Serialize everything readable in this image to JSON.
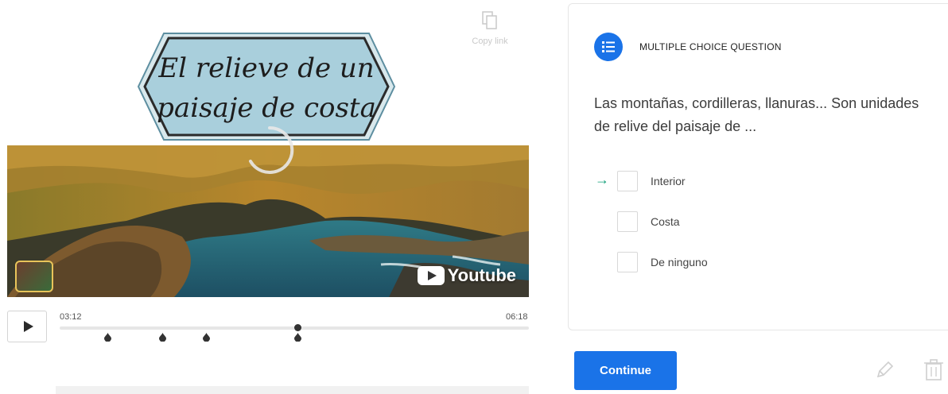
{
  "video": {
    "copy_link_label": "Copy link",
    "title_line1": "El relieve de un",
    "title_line2": "paisaje de costa",
    "youtube_label": "Youtube",
    "current_time": "03:12",
    "duration": "06:18",
    "progress_fraction": 0.508,
    "marker_fractions": [
      0.103,
      0.219,
      0.312,
      0.508
    ]
  },
  "question": {
    "type_label": "MULTIPLE CHOICE QUESTION",
    "text": "Las montañas, cordilleras, llanuras... Son unidades de relive del paisaje de ...",
    "options": [
      {
        "label": "Interior"
      },
      {
        "label": "Costa"
      },
      {
        "label": "De ninguno"
      }
    ],
    "continue_label": "Continue"
  },
  "colors": {
    "accent": "#1a73e8",
    "arrow": "#0f9d77"
  },
  "icons": {
    "copy": "copy-icon",
    "list": "list-icon",
    "play": "play-icon",
    "edit": "pencil-icon",
    "delete": "trash-icon"
  }
}
